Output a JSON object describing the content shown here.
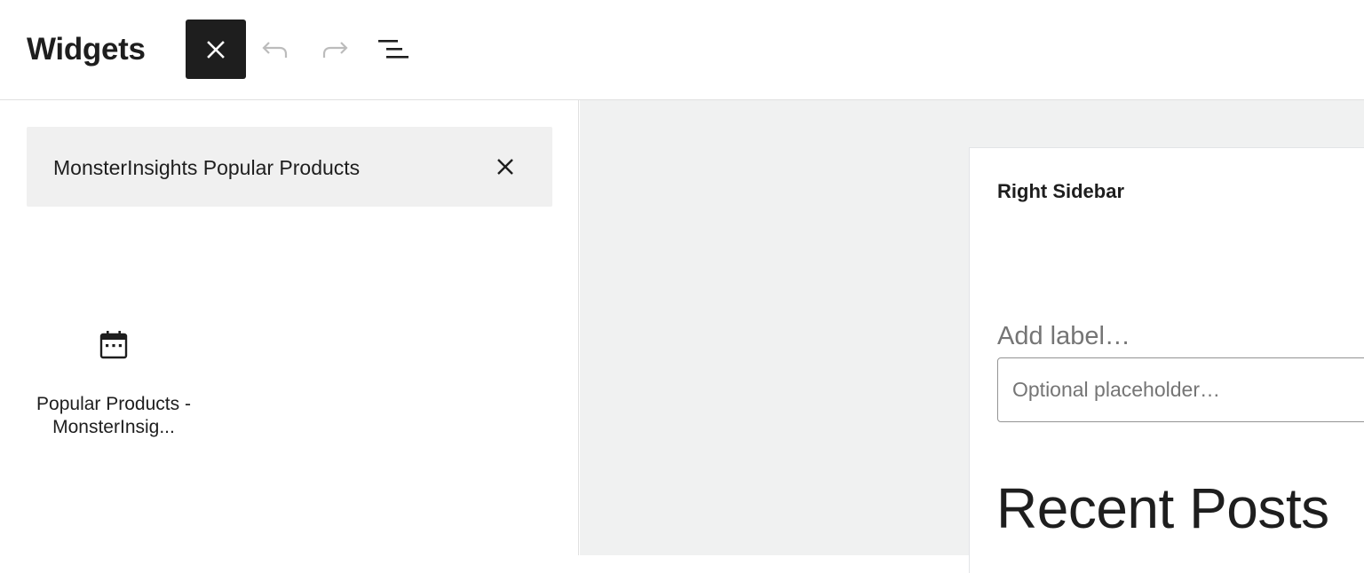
{
  "header": {
    "title": "Widgets"
  },
  "inserter": {
    "search_value": "MonsterInsights Popular Products",
    "results": [
      {
        "label": "Popular Products - MonsterInsig...",
        "icon": "calendar-icon"
      }
    ]
  },
  "canvas": {
    "area_title": "Right Sidebar",
    "search_label": "Add label…",
    "search_placeholder": "Optional placeholder…",
    "heading": "Recent Posts"
  },
  "colors": {
    "topbar_bg": "#ffffff",
    "close_button_bg": "#1e1e1e",
    "search_bar_bg": "#f0f0f0",
    "canvas_bg": "#f0f1f1",
    "muted_text": "#757575"
  }
}
